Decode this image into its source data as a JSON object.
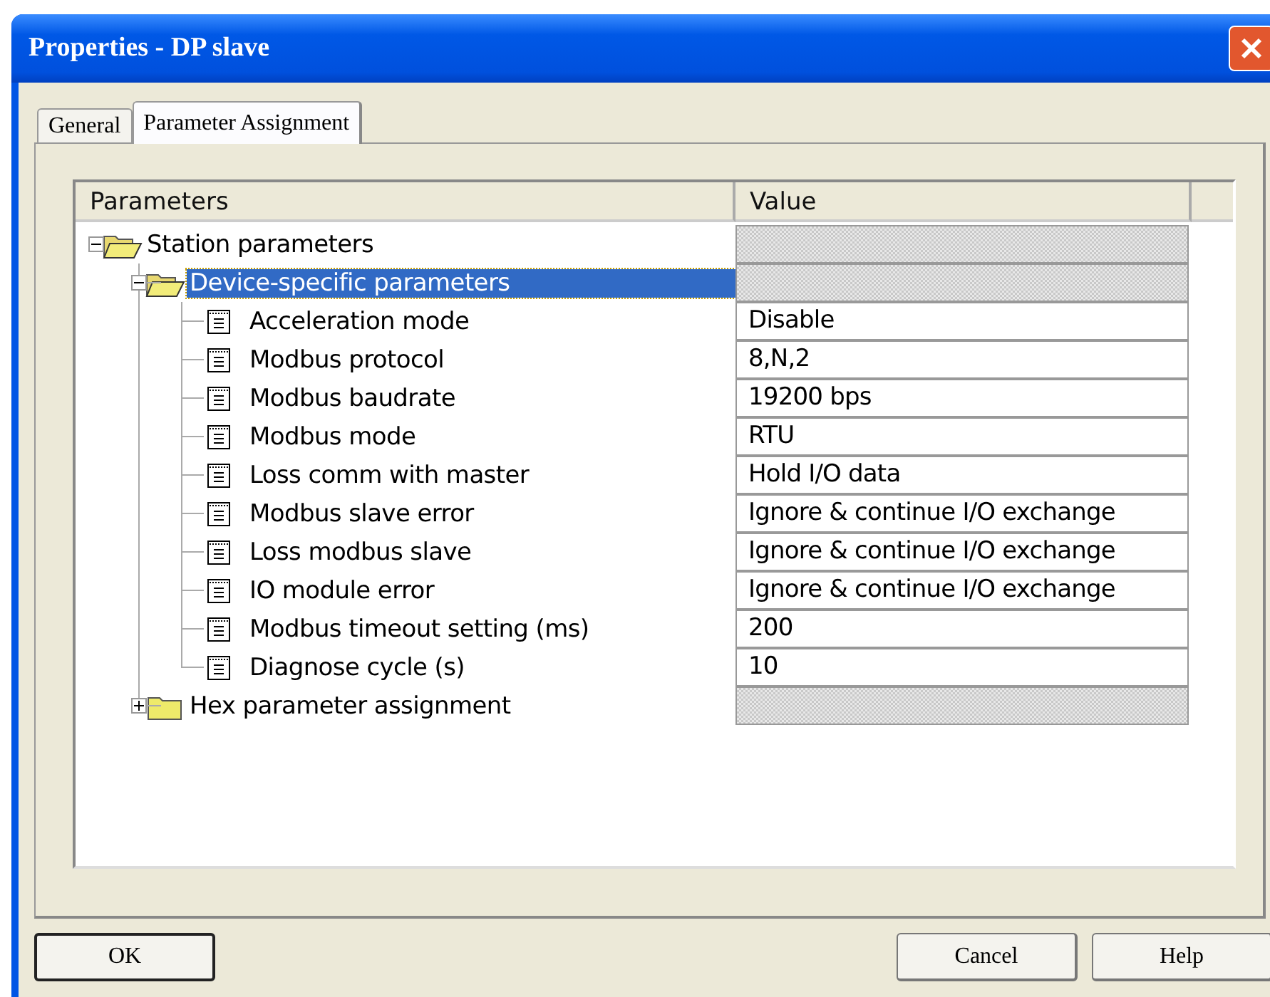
{
  "window": {
    "title": "Properties - DP slave"
  },
  "tabs": [
    {
      "label": "General",
      "selected": false
    },
    {
      "label": "Parameter Assignment",
      "selected": true
    }
  ],
  "table": {
    "columns": [
      "Parameters",
      "Value"
    ],
    "tree": [
      {
        "kind": "folder",
        "label": "Station parameters",
        "expanded": true,
        "selected": false,
        "children": [
          {
            "kind": "folder",
            "label": "Device-specific parameters",
            "expanded": true,
            "selected": true,
            "children": [
              {
                "kind": "parameter",
                "label": "Acceleration mode",
                "value": "Disable",
                "selected": false
              },
              {
                "kind": "parameter",
                "label": "Modbus protocol",
                "value": "8,N,2",
                "selected": false
              },
              {
                "kind": "parameter",
                "label": "Modbus baudrate",
                "value": "19200 bps",
                "selected": false
              },
              {
                "kind": "parameter",
                "label": "Modbus mode",
                "value": "RTU",
                "selected": false
              },
              {
                "kind": "parameter",
                "label": "Loss comm with master",
                "value": "Hold I/O data",
                "selected": false
              },
              {
                "kind": "parameter",
                "label": "Modbus slave error",
                "value": "Ignore & continue I/O exchange",
                "selected": false
              },
              {
                "kind": "parameter",
                "label": "Loss modbus slave",
                "value": "Ignore & continue I/O exchange",
                "selected": false
              },
              {
                "kind": "parameter",
                "label": "IO module error",
                "value": "Ignore & continue I/O exchange",
                "selected": false
              },
              {
                "kind": "parameter",
                "label": "Modbus timeout setting (ms)",
                "value": "200",
                "selected": false
              },
              {
                "kind": "parameter",
                "label": "Diagnose cycle (s)",
                "value": "10",
                "selected": false
              }
            ]
          },
          {
            "kind": "folder",
            "label": "Hex parameter assignment",
            "expanded": false,
            "selected": false
          }
        ]
      }
    ]
  },
  "buttons": [
    "OK",
    "Cancel",
    "Help"
  ]
}
